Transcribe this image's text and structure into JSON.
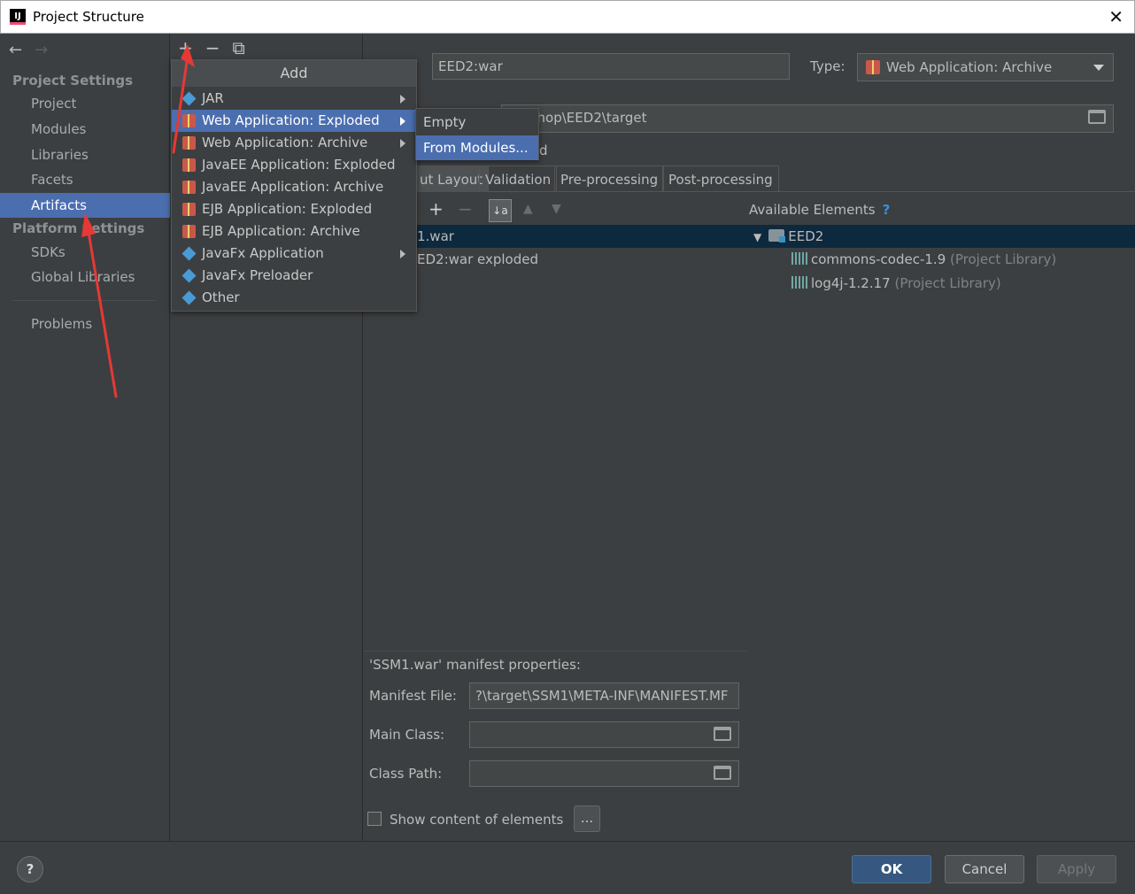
{
  "window": {
    "title": "Project Structure",
    "close": "✕"
  },
  "nav": {
    "back": "←",
    "forward": "→"
  },
  "sidebar": {
    "project_settings": "Project Settings",
    "items_a": [
      "Project",
      "Modules",
      "Libraries",
      "Facets",
      "Artifacts"
    ],
    "platform_settings": "Platform Settings",
    "items_b": [
      "SDKs",
      "Global Libraries"
    ],
    "problems": "Problems",
    "selected": "Artifacts"
  },
  "midtools": {
    "add": "+",
    "remove": "−",
    "copy": "⧉"
  },
  "add_menu": {
    "title": "Add",
    "items": [
      {
        "label": "JAR",
        "icon": "diamond-icon",
        "submenu": true
      },
      {
        "label": "Web Application: Exploded",
        "icon": "gift-icon",
        "submenu": true,
        "selected": true
      },
      {
        "label": "Web Application: Archive",
        "icon": "gift-icon",
        "submenu": true
      },
      {
        "label": "JavaEE Application: Exploded",
        "icon": "gift-icon"
      },
      {
        "label": "JavaEE Application: Archive",
        "icon": "gift-icon"
      },
      {
        "label": "EJB Application: Exploded",
        "icon": "gift-icon"
      },
      {
        "label": "EJB Application: Archive",
        "icon": "gift-icon"
      },
      {
        "label": "JavaFx Application",
        "icon": "diamond-icon",
        "submenu": true
      },
      {
        "label": "JavaFx Preloader",
        "icon": "diamond-icon"
      },
      {
        "label": "Other",
        "icon": "diamond-icon"
      }
    ]
  },
  "sub_menu": {
    "items": [
      "Empty",
      "From Modules..."
    ],
    "selected": "From Modules..."
  },
  "artifact": {
    "name_value": "EED2:war",
    "type_label": "Type:",
    "type_value": "Web Application: Archive",
    "output_value": "orkShop\\EED2\\target",
    "partial_d": "d"
  },
  "tabs": [
    "ut Layout",
    "Validation",
    "Pre-processing",
    "Post-processing"
  ],
  "layout_tree": {
    "root": "1.war",
    "child": "ED2:war exploded"
  },
  "available": {
    "header": "Available Elements",
    "help": "?",
    "module": "EED2",
    "libs": [
      {
        "name": "commons-codec-1.9",
        "note": "(Project Library)"
      },
      {
        "name": "log4j-1.2.17",
        "note": "(Project Library)"
      }
    ]
  },
  "manifest": {
    "title": "'SSM1.war' manifest properties:",
    "file_label": "Manifest File:",
    "file_value": "?\\target\\SSM1\\META-INF\\MANIFEST.MF",
    "main_class_label": "Main Class:",
    "class_path_label": "Class Path:",
    "show_content": "Show content of elements",
    "dots": "..."
  },
  "buttons": {
    "help": "?",
    "ok": "OK",
    "cancel": "Cancel",
    "apply": "Apply"
  },
  "colors": {
    "selection": "#4b6eaf",
    "background": "#3c3f41",
    "annotation": "#e53935"
  }
}
